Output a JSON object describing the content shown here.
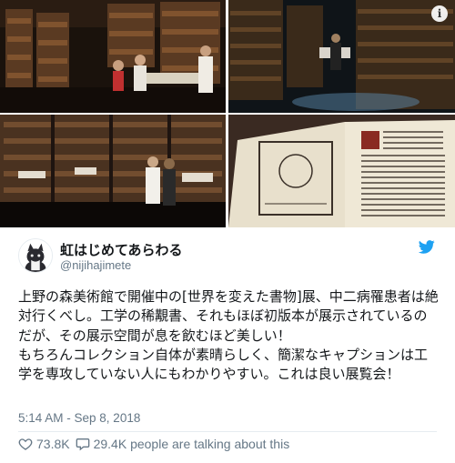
{
  "header": {
    "display_name": "虹はじめてあらわる",
    "handle": "@nijihajimete",
    "avatar_icon": "avatar-cat-icon",
    "platform_icon": "twitter-bird-icon",
    "brand_color": "#1da1f2"
  },
  "media": {
    "info_glyph": "i",
    "photos": [
      {
        "icon": "library-bookshelves-photo"
      },
      {
        "icon": "library-corridor-photo"
      },
      {
        "icon": "library-display-cases-photo"
      },
      {
        "icon": "open-antique-book-photo"
      }
    ]
  },
  "tweet": {
    "text": "上野の森美術館で開催中の[世界を変えた書物]展、中二病罹患者は絶対行くべし。工学の稀覯書、それもほぼ初版本が展示されているのだが、その展示空間が息を飲むほど美しい！\nもちろんコレクション自体が素晴らしく、簡潔なキャプションは工学を専攻していない人にもわかりやすい。これは良い展覧会！",
    "timestamp": "5:14 AM - Sep 8, 2018"
  },
  "actions": {
    "like_count": "73.8K",
    "like_icon": "heart-icon",
    "reply_summary": "29.4K people are talking about this",
    "reply_icon": "speech-bubble-icon"
  }
}
